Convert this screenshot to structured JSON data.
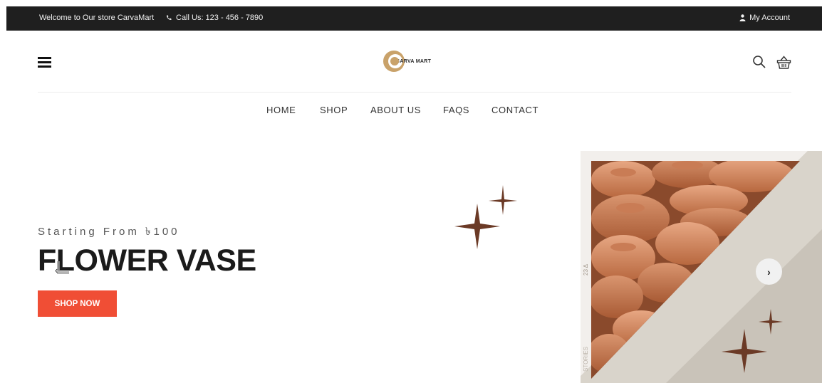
{
  "topbar": {
    "welcome": "Welcome to Our store CarvaMart",
    "call": "Call Us: 123 - 456 - 7890",
    "account": "My Account"
  },
  "header": {
    "logo_text": "CARVA MART",
    "icons": [
      "menu-icon",
      "search-icon",
      "basket-icon"
    ]
  },
  "nav": {
    "items": [
      "HOME",
      "SHOP",
      "ABOUT US",
      "FAQS",
      "CONTACT"
    ]
  },
  "hero": {
    "subtitle": "Starting From ৳100",
    "title": "FLOWER VASE",
    "button": "SHOP NOW",
    "image_side_text": [
      "23 Δ",
      "STORIES"
    ]
  },
  "colors": {
    "topbar": "#1f1f1f",
    "accent": "#f04e35",
    "sparkle": "#6b3a26",
    "logo_gold": "#c9a26a"
  }
}
